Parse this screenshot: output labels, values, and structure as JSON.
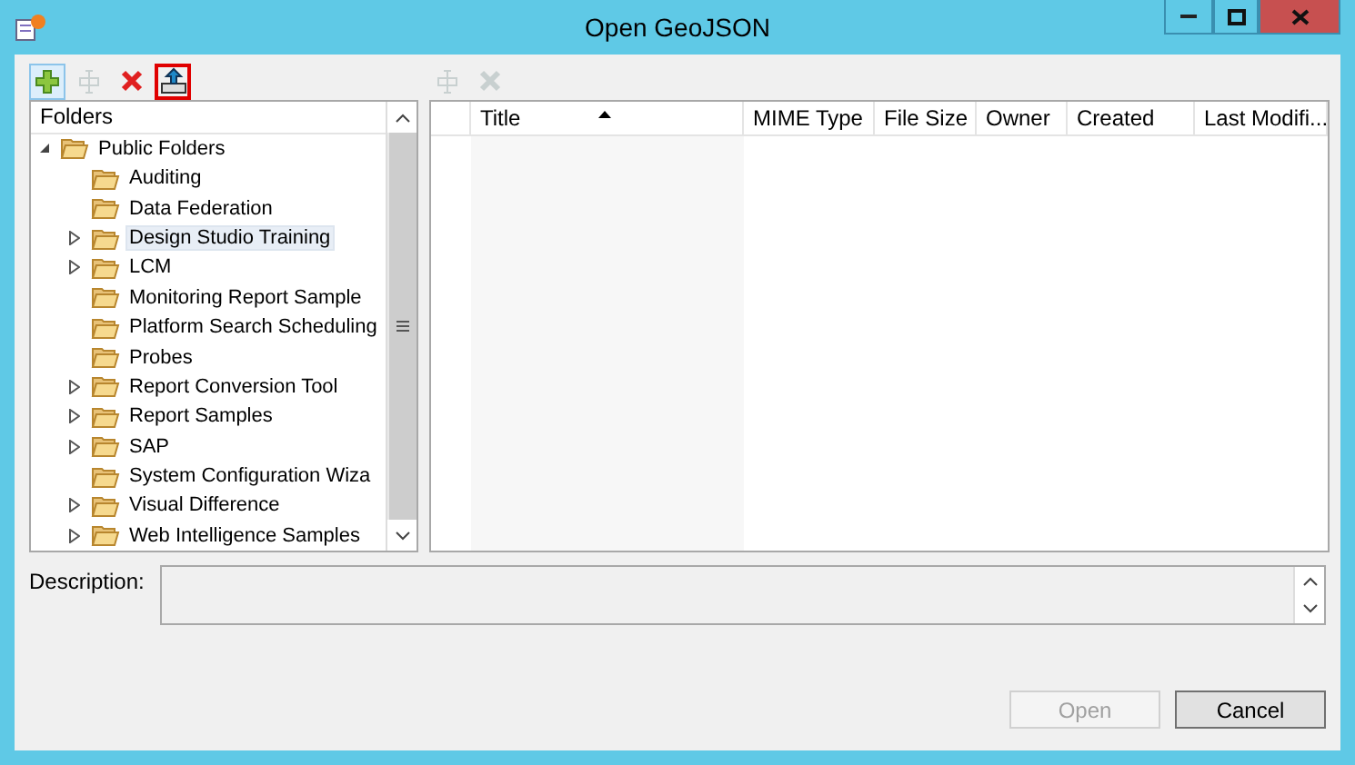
{
  "window": {
    "title": "Open GeoJSON"
  },
  "folder_toolbar": [
    {
      "kind": "add",
      "disabled": false,
      "highlighted": false
    },
    {
      "kind": "rename",
      "disabled": true,
      "highlighted": false
    },
    {
      "kind": "delete",
      "disabled": false,
      "highlighted": false
    },
    {
      "kind": "upload",
      "disabled": false,
      "highlighted": true
    }
  ],
  "file_toolbar": [
    {
      "kind": "rename",
      "disabled": true,
      "highlighted": false
    },
    {
      "kind": "delete",
      "disabled": true,
      "highlighted": false
    }
  ],
  "tree": {
    "header": "Folders",
    "items": [
      {
        "label": "Public Folders",
        "expanded": true,
        "selected": false,
        "children": [
          {
            "label": "Auditing",
            "expandable": false,
            "selected": false
          },
          {
            "label": "Data Federation",
            "expandable": false,
            "selected": false
          },
          {
            "label": "Design Studio Training",
            "expandable": true,
            "selected": true
          },
          {
            "label": "LCM",
            "expandable": true,
            "selected": false
          },
          {
            "label": "Monitoring Report Sample",
            "expandable": false,
            "selected": false
          },
          {
            "label": "Platform Search Scheduling",
            "expandable": false,
            "selected": false
          },
          {
            "label": "Probes",
            "expandable": false,
            "selected": false
          },
          {
            "label": "Report Conversion Tool",
            "expandable": true,
            "selected": false
          },
          {
            "label": "Report Samples",
            "expandable": true,
            "selected": false
          },
          {
            "label": "SAP",
            "expandable": true,
            "selected": false
          },
          {
            "label": "System Configuration Wiza",
            "expandable": false,
            "selected": false
          },
          {
            "label": "Visual Difference",
            "expandable": true,
            "selected": false
          },
          {
            "label": "Web Intelligence Samples",
            "expandable": true,
            "selected": false
          }
        ]
      }
    ]
  },
  "table": {
    "columns": [
      {
        "label": "Title",
        "sorted": true
      },
      {
        "label": "MIME Type",
        "sorted": false
      },
      {
        "label": "File Size",
        "sorted": false
      },
      {
        "label": "Owner",
        "sorted": false
      },
      {
        "label": "Created",
        "sorted": false
      },
      {
        "label": "Last Modifi...",
        "sorted": false
      }
    ]
  },
  "description": {
    "label": "Description:"
  },
  "buttons": [
    {
      "label": "Open",
      "disabled": true
    },
    {
      "label": "Cancel",
      "disabled": false
    }
  ]
}
